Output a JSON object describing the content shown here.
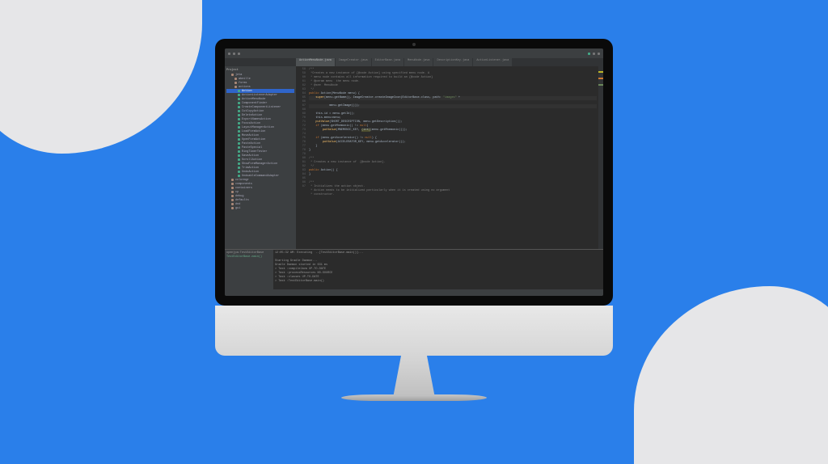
{
  "page_background": "#2a7fea",
  "wave_color": "#e6e6e8",
  "ide": {
    "topbar_project": "Project",
    "tabs": [
      {
        "label": "ActionMenuNode.java"
      },
      {
        "label": "ImageCreator.java"
      },
      {
        "label": "EditorBase.java"
      },
      {
        "label": "MenuNode.java"
      },
      {
        "label": "DescriptionKey.java"
      },
      {
        "label": "ActionListener.java"
      }
    ],
    "active_tab": 0,
    "sidebar": {
      "header": "Project",
      "root": "jeta",
      "nodes": [
        "abeille",
        "forms",
        "actions"
      ],
      "selected": "Action",
      "files": [
        "Action",
        "ActionListenerAdapter",
        "ActionMenuNode",
        "ComponentFinder",
        "CreateComponentListener",
        "CutCopyAction",
        "DeleteAction",
        "ExportNamesAction",
        "FocusAction",
        "LayoutManagerAction",
        "LoadFormAction",
        "MoveAction",
        "OpenFormAction",
        "PasteAction",
        "PasteSpecial",
        "RingTimerTester",
        "SaveAction",
        "ScrollAction",
        "ShowFormManagerAction",
        "TrimAction",
        "UndoAction",
        "UndoableCommandAdapter"
      ],
      "folders": [
        "colormgr",
        "components",
        "containers",
        "cp",
        "debug",
        "defaults",
        "dnd",
        "gui"
      ]
    },
    "editor": {
      "first_line": 58,
      "lines": [
        {
          "t": "/**",
          "cls": "cm"
        },
        {
          "t": " *Creates a new instance of {@code Action} using specified menu node. A",
          "cls": "cm"
        },
        {
          "t": " * menu node contains all information required to build an {@code Action}",
          "cls": "cm"
        },
        {
          "t": " * @param menu  the menu node.",
          "cls": "cm"
        },
        {
          "t": " * @see  MenuNode",
          "cls": "cm"
        },
        {
          "t": " */",
          "cls": "cm"
        },
        {
          "t": "public Action(MenuNode menu) {",
          "kw": [
            "public"
          ]
        },
        {
          "t": "    super(menu.getName(), ImageCreator.createImageIcon(EditorBase.class, path: \"images\" +",
          "hl": true,
          "fn": "super",
          "str": "\"images\""
        },
        {
          "t": "            menu.getImage()));",
          "hl": true
        },
        {
          "t": "    this.id = menu.getId();"
        },
        {
          "t": "    this.menu=menu;"
        },
        {
          "t": "    putValue(SHORT_DESCRIPTION, menu.getDescription());",
          "fn": "putValue"
        },
        {
          "t": "    if (menu.getMnemonic() != null)",
          "kw": [
            "if",
            "null"
          ]
        },
        {
          "t": "        putValue(MNEMONIC_KEY, (int)(menu.getMnemonic()));",
          "fn": "putValue",
          "box": true
        },
        {
          "t": ""
        },
        {
          "t": "    if (menu.getAccelerator() != null) {",
          "kw": [
            "if",
            "null"
          ]
        },
        {
          "t": "        putValue(ACCELERATOR_KEY, menu.getAccelerator());",
          "fn": "putValue"
        },
        {
          "t": "    }"
        },
        {
          "t": "}"
        },
        {
          "t": ""
        },
        {
          "t": "/**",
          "cls": "cm"
        },
        {
          "t": " * Creates a new instance of  {@code Action}.",
          "cls": "cm"
        },
        {
          "t": " */",
          "cls": "cm"
        },
        {
          "t": "public Action() {",
          "kw": [
            "public"
          ]
        },
        {
          "t": "}"
        },
        {
          "t": ""
        },
        {
          "t": "/**",
          "cls": "cm"
        },
        {
          "t": " * Initializes the action object.",
          "cls": "cm"
        },
        {
          "t": " * Action needs to be initialized particularly when it is created using no argument",
          "cls": "cm"
        },
        {
          "t": " * constructor.",
          "cls": "cm"
        }
      ]
    },
    "console": {
      "tab": "Run",
      "title": "openjpa:TestEditorBase",
      "config": "TestEditorBase.main()",
      "header": "12:05:32 AM: Executing  ..[TestEditorBase.main()]...",
      "lines": [
        "Starting Gradle Daemon...",
        "Gradle Daemon started in 631 ms",
        "> Task :compileJava UP-TO-DATE",
        "> Task :processResources NO-SOURCE",
        "> Task :classes UP-TO-DATE",
        "> Task :TestEditorBase.main()"
      ]
    }
  }
}
